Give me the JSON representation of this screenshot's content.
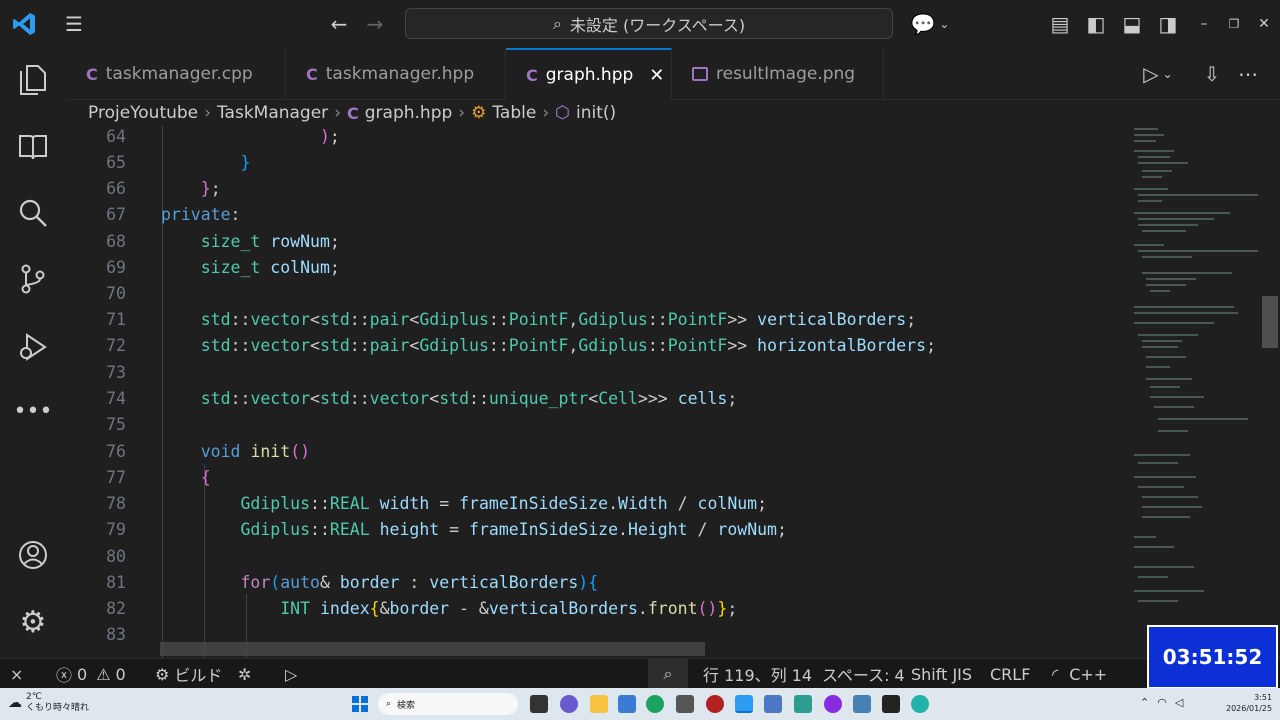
{
  "titlebar": {
    "command_center": "未設定 (ワークスペース)"
  },
  "tabs": [
    {
      "label": "taskmanager.cpp",
      "icon": "cpp-file-icon"
    },
    {
      "label": "taskmanager.hpp",
      "icon": "cpp-file-icon"
    },
    {
      "label": "graph.hpp",
      "icon": "cpp-file-icon",
      "active": true
    },
    {
      "label": "resultImage.png",
      "icon": "image-file-icon"
    }
  ],
  "tab_icon_glyph": "C",
  "breadcrumb": [
    "ProjeYoutube",
    "TaskManager",
    "graph.hpp",
    "Table",
    "init()"
  ],
  "editor": {
    "lines": [
      {
        "n": "64"
      },
      {
        "n": "65"
      },
      {
        "n": "66"
      },
      {
        "n": "67"
      },
      {
        "n": "68"
      },
      {
        "n": "69"
      },
      {
        "n": "70"
      },
      {
        "n": "71"
      },
      {
        "n": "72"
      },
      {
        "n": "73"
      },
      {
        "n": "74"
      },
      {
        "n": "75"
      },
      {
        "n": "76"
      },
      {
        "n": "77"
      },
      {
        "n": "78"
      },
      {
        "n": "79"
      },
      {
        "n": "80"
      },
      {
        "n": "81"
      },
      {
        "n": "82"
      },
      {
        "n": "83"
      }
    ]
  },
  "statusbar": {
    "errors": "0",
    "warnings": "0",
    "build": "ビルド",
    "position": "行 119、列 14",
    "spaces": "スペース: 4",
    "encoding": "Shift JIS",
    "eol": "CRLF",
    "language": "C++"
  },
  "clock": "03:51:52",
  "taskbar": {
    "weather_temp": "2℃",
    "weather_desc": "くもり時々晴れ",
    "search": "検索",
    "time": "3:51",
    "date": "2026/01/25"
  },
  "colors": {
    "accent": "#0078d4",
    "clock_bg": "#0d2fd6"
  }
}
